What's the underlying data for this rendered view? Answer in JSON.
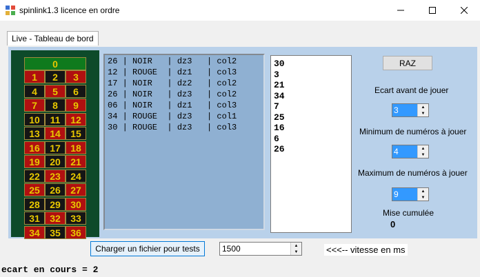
{
  "window": {
    "title": "spinlink1.3 licence en ordre",
    "icon": "app-icon",
    "controls": [
      "minimize-icon",
      "maximize-icon",
      "close-icon"
    ]
  },
  "tab": {
    "label": "Live - Tableau de bord"
  },
  "roulette": {
    "zero": "0",
    "rows": [
      [
        "1",
        "2",
        "3"
      ],
      [
        "4",
        "5",
        "6"
      ],
      [
        "7",
        "8",
        "9"
      ],
      [
        "10",
        "11",
        "12"
      ],
      [
        "13",
        "14",
        "15"
      ],
      [
        "16",
        "17",
        "18"
      ],
      [
        "19",
        "20",
        "21"
      ],
      [
        "22",
        "23",
        "24"
      ],
      [
        "25",
        "26",
        "27"
      ],
      [
        "28",
        "29",
        "30"
      ],
      [
        "31",
        "32",
        "33"
      ],
      [
        "34",
        "35",
        "36"
      ]
    ],
    "colors": {
      "red_numbers": [
        1,
        3,
        5,
        7,
        9,
        12,
        14,
        16,
        18,
        19,
        21,
        23,
        25,
        27,
        30,
        32,
        34,
        36
      ],
      "red": "#b01010",
      "black": "#151515",
      "green": "#0f7a1d",
      "number_text": "#e8c800"
    }
  },
  "log": {
    "lines": [
      "26 | NOIR   | dz3   | col2",
      "12 | ROUGE  | dz1   | col3",
      "17 | NOIR   | dz2   | col2",
      "26 | NOIR   | dz3   | col2",
      "06 | NOIR   | dz1   | col3",
      "34 | ROUGE  | dz3   | col1",
      "30 | ROUGE  | dz3   | col3"
    ]
  },
  "numbers": [
    "30",
    "3",
    "21",
    "34",
    "7",
    "25",
    "16",
    "6",
    "26"
  ],
  "controls": {
    "raz_label": "RAZ",
    "ecart_label": "Ecart avant de jouer",
    "ecart_value": "3",
    "min_label": "Minimum de numéros à jouer",
    "min_value": "4",
    "max_label": "Maximum de numéros à jouer",
    "max_value": "9",
    "mise_label": "Mise cumulée",
    "mise_value": "0"
  },
  "bottom": {
    "load_button": "Charger un fichier pour tests",
    "speed_value": "1500",
    "speed_hint": "<<<-- vitesse en ms"
  },
  "status": {
    "text": "ecart en cours = 2"
  },
  "colors": {
    "panel": "#b9d1ea",
    "log_bg": "#8fb0d2",
    "accent": "#3399ff"
  }
}
